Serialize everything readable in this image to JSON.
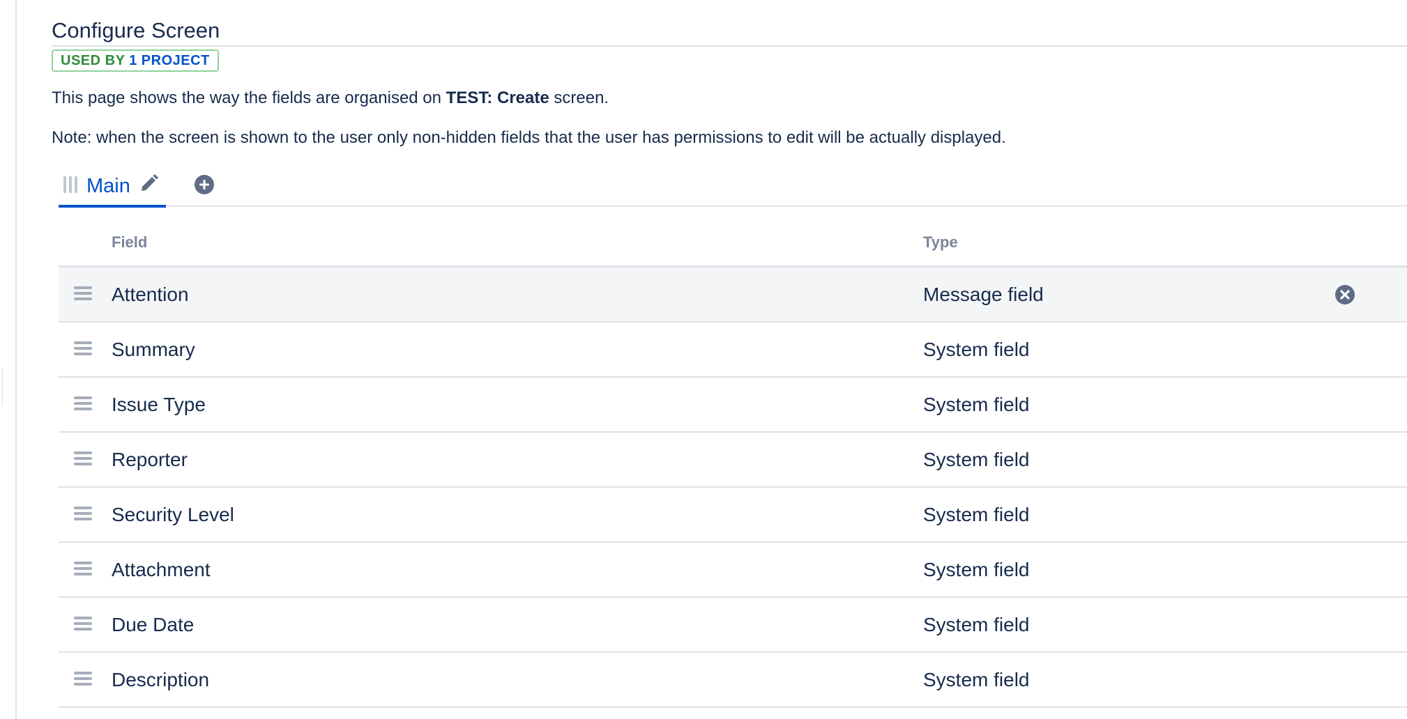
{
  "page": {
    "title": "Configure Screen",
    "usage_badge": {
      "prefix": "USED BY",
      "count": "1",
      "suffix": "PROJECT"
    },
    "description": {
      "before": "This page shows the way the fields are organised on ",
      "screen_name": "TEST: Create",
      "after": " screen."
    },
    "note": "Note: when the screen is shown to the user only non-hidden fields that the user has permissions to edit will be actually displayed."
  },
  "tabs": {
    "items": [
      {
        "label": "Main",
        "active": true
      }
    ],
    "icons": {
      "grip": "drag-grip-icon",
      "edit": "pencil-icon",
      "add": "add-circle-icon"
    }
  },
  "table": {
    "columns": [
      "Field",
      "Type"
    ],
    "rows": [
      {
        "field": "Attention",
        "type": "Message field",
        "hovered": true
      },
      {
        "field": "Summary",
        "type": "System field"
      },
      {
        "field": "Issue Type",
        "type": "System field"
      },
      {
        "field": "Reporter",
        "type": "System field"
      },
      {
        "field": "Security Level",
        "type": "System field"
      },
      {
        "field": "Attachment",
        "type": "System field"
      },
      {
        "field": "Due Date",
        "type": "System field"
      },
      {
        "field": "Description",
        "type": "System field"
      }
    ],
    "icons": {
      "drag": "drag-handle-icon",
      "remove": "remove-circle-icon"
    }
  },
  "colors": {
    "text": "#172b4d",
    "link_blue": "#0052cc",
    "badge_green": "#2e8b3a",
    "muted": "#7a869a",
    "hover_row": "#f4f5f7",
    "icon_dark": "#5e6c84"
  }
}
